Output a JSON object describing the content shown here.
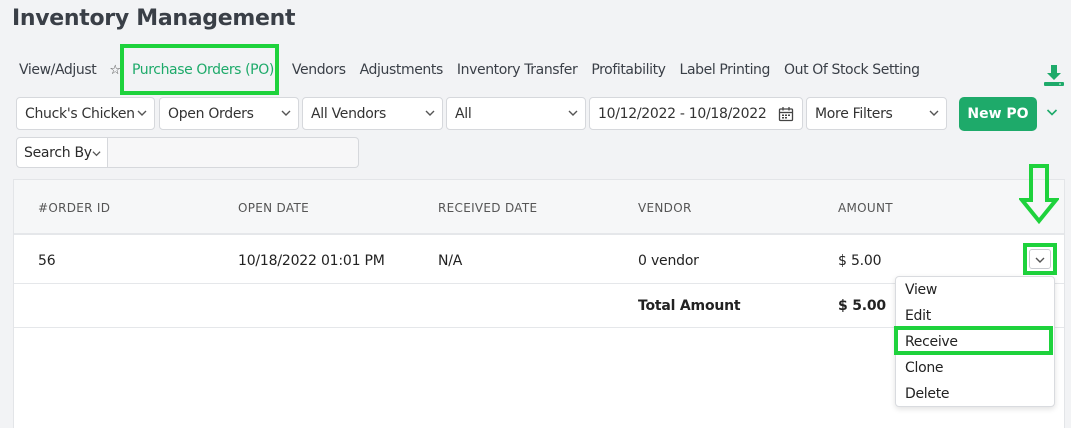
{
  "page": {
    "title": "Inventory Management"
  },
  "tabs": [
    {
      "label": "View/Adjust"
    },
    {
      "label": "Purchase Orders (PO)",
      "active": true
    },
    {
      "label": "Vendors"
    },
    {
      "label": "Adjustments"
    },
    {
      "label": "Inventory Transfer"
    },
    {
      "label": "Profitability"
    },
    {
      "label": "Label Printing"
    },
    {
      "label": "Out Of Stock Setting"
    }
  ],
  "filters": {
    "store": "Chuck's Chicken",
    "status": "Open Orders",
    "vendor": "All Vendors",
    "type": "All",
    "date_range": "10/12/2022 - 10/18/2022",
    "more": "More Filters",
    "search_by": "Search By",
    "search_value": ""
  },
  "actions": {
    "new_po": "New PO"
  },
  "table": {
    "headers": [
      "#ORDER ID",
      "OPEN DATE",
      "RECEIVED DATE",
      "VENDOR",
      "AMOUNT"
    ],
    "rows": [
      {
        "order_id": "56",
        "open_date": "10/18/2022 01:01 PM",
        "received_date": "N/A",
        "vendor": "0 vendor",
        "amount": "$ 5.00"
      }
    ],
    "total_label": "Total Amount",
    "total_value": "$ 5.00"
  },
  "row_menu": [
    "View",
    "Edit",
    "Receive",
    "Clone",
    "Delete"
  ],
  "colors": {
    "accent": "#1eaa6a",
    "highlight": "#1ed23c"
  },
  "icons": [
    "star-icon",
    "download-icon",
    "chevron-down-icon",
    "calendar-icon",
    "arrow-down-icon"
  ]
}
